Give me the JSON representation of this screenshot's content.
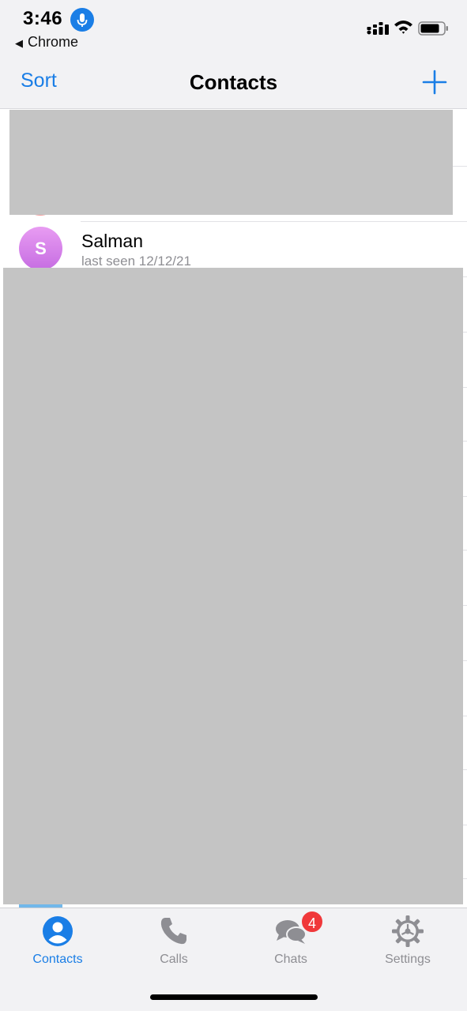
{
  "status_bar": {
    "time": "3:46",
    "back_app": "Chrome",
    "mic_icon": "microphone-icon",
    "signal_icon": "cellular-signal-icon",
    "wifi_icon": "wifi-icon",
    "battery_icon": "battery-icon",
    "accent_color": "#1a7ee6"
  },
  "nav": {
    "sort_label": "Sort",
    "title": "Contacts",
    "add_icon": "plus-icon"
  },
  "contacts": [
    {
      "initial": "S",
      "name": "Salman",
      "status": "last seen 12/12/21"
    }
  ],
  "tabs": [
    {
      "label": "Contacts",
      "icon": "person-circle-icon",
      "active": true
    },
    {
      "label": "Calls",
      "icon": "phone-icon",
      "active": false
    },
    {
      "label": "Chats",
      "icon": "chat-bubbles-icon",
      "active": false,
      "badge": "4"
    },
    {
      "label": "Settings",
      "icon": "gear-icon",
      "active": false
    }
  ],
  "colors": {
    "accent": "#1a7ee6",
    "badge": "#f0383a",
    "inactive": "#8e8e93",
    "avatar_gradient": [
      "#e89cf2",
      "#c66de2"
    ]
  }
}
